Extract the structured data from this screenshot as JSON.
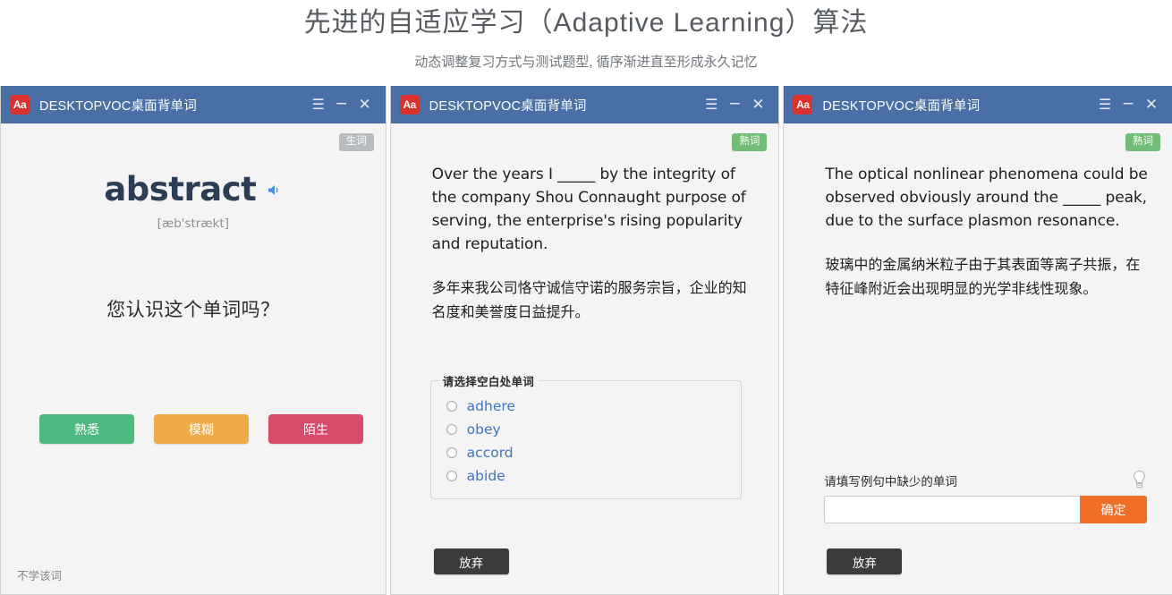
{
  "header": {
    "title": "先进的自适应学习（Adaptive Learning）算法",
    "subtitle": "动态调整复习方式与测试题型, 循序渐进直至形成永久记忆"
  },
  "colors": {
    "titlebar": "#4a6fa7",
    "logo": "#d8312e",
    "familiar": "#4cba7e",
    "vague": "#efab48",
    "unknown": "#d9496a",
    "confirm": "#ef6e28",
    "badge_new": "#b9bcbf",
    "badge_known": "#72bd76",
    "word": "#2c3e56",
    "option_text": "#3f73c4"
  },
  "window_controls": {
    "menu": "☰",
    "minimize": "−",
    "close": "✕"
  },
  "panel1": {
    "app_logo": "Aa",
    "app_title": "DESKTOPVOC桌面背单词",
    "badge": "生词",
    "word": "abstract",
    "speaker_icon": "speaker-icon",
    "phonetic": "[æb'strækt]",
    "question": "您认识这个单词吗？",
    "buttons": [
      {
        "label": "熟悉",
        "name": "familiar"
      },
      {
        "label": "模糊",
        "name": "vague"
      },
      {
        "label": "陌生",
        "name": "unknown"
      }
    ],
    "skip_link": "不学该词"
  },
  "panel2": {
    "app_logo": "Aa",
    "app_title": "DESKTOPVOC桌面背单词",
    "badge": "熟词",
    "sentence_en": "Over the years I _____ by the integrity of the company Shou Connaught purpose of serving, the enterprise's rising popularity and reputation.",
    "sentence_cn": "多年来我公司恪守诚信守诺的服务宗旨，企业的知名度和美誉度日益提升。",
    "options_legend": "请选择空白处单词",
    "options": [
      "adhere",
      "obey",
      "accord",
      "abide"
    ],
    "giveup_label": "放弃"
  },
  "panel3": {
    "app_logo": "Aa",
    "app_title": "DESKTOPVOC桌面背单词",
    "badge": "熟词",
    "sentence_en": "The optical nonlinear phenomena could be observed obviously around the _____ peak, due to the surface plasmon resonance.",
    "sentence_cn": "玻璃中的金属纳米粒子由于其表面等离子共振，在特征峰附近会出现明显的光学非线性现象。",
    "fill_label": "请填写例句中缺少的单词",
    "hint_icon": "lightbulb-icon",
    "input_value": "",
    "input_placeholder": "",
    "confirm_label": "确定",
    "giveup_label": "放弃"
  }
}
